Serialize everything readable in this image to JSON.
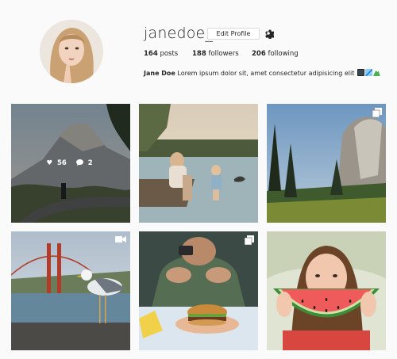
{
  "profile": {
    "username": "janedoe_",
    "edit_profile_label": "Edit Profile",
    "settings_icon": "gear-icon",
    "stats": {
      "posts_count": "164",
      "posts_label": "posts",
      "followers_count": "188",
      "followers_label": "followers",
      "following_count": "206",
      "following_label": "following"
    },
    "bio_name": "Jane Doe",
    "bio_text": "Lorem ipsum dolor sit, amet consectetur adipisicing elit",
    "bio_emojis": [
      "camera-emoji",
      "airplane-emoji",
      "mountain-emoji"
    ]
  },
  "posts": [
    {
      "subject": "mountain valley road at dusk",
      "hovered": true,
      "likes": "56",
      "comments": "2",
      "badge": "none"
    },
    {
      "subject": "mother and child at lake",
      "hovered": false,
      "badge": "none"
    },
    {
      "subject": "granite cliff and pine trees",
      "hovered": false,
      "badge": "carousel"
    },
    {
      "subject": "seagull and red bridge",
      "hovered": false,
      "badge": "video"
    },
    {
      "subject": "man with burger on table",
      "hovered": false,
      "badge": "carousel"
    },
    {
      "subject": "woman holding watermelon slice",
      "hovered": false,
      "badge": "none"
    }
  ],
  "colors": {
    "background": "#fafafa",
    "text": "#262626",
    "button_border": "#dbdbdb"
  }
}
